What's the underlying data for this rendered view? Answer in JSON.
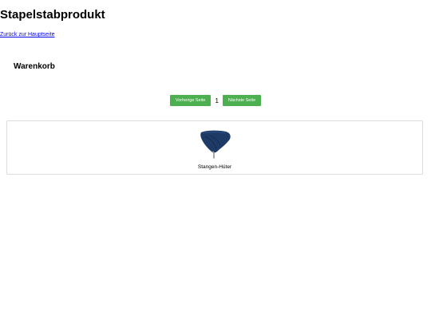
{
  "header": {
    "title": "Stapelstabprodukt",
    "back_link": "Zurück zur Hauptseite"
  },
  "section": {
    "title": "Warenkorb"
  },
  "pagination": {
    "prev_label": "Vorherige Seite",
    "current_page": "1",
    "next_label": "Nächste Seite",
    "button_color": "#4caf50"
  },
  "products": [
    {
      "name": "Stangen-Hüter",
      "icon": "club-headcover-image"
    }
  ]
}
